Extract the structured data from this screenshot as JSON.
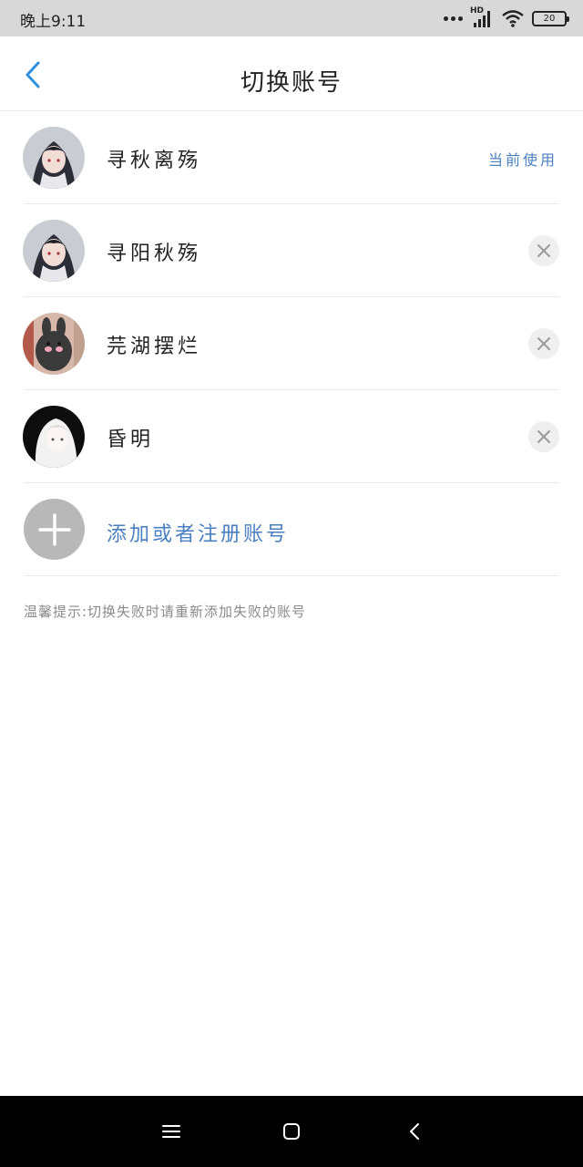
{
  "status_bar": {
    "time": "晚上9:11",
    "network_label": "HD",
    "battery_level": "20",
    "icons": [
      "more-dots-icon",
      "signal-icon",
      "wifi-icon",
      "battery-icon"
    ]
  },
  "header": {
    "title": "切换账号",
    "back_icon": "chevron-left-icon"
  },
  "accounts": [
    {
      "name": "寻秋离殇",
      "status": "当前使用",
      "avatar": "anime-hoodie-avatar"
    },
    {
      "name": "寻阳秋殇",
      "status": "",
      "avatar": "anime-hoodie-avatar",
      "action_icon": "close-icon"
    },
    {
      "name": "芫湖摆烂",
      "status": "",
      "avatar": "dark-bunny-avatar",
      "action_icon": "close-icon"
    },
    {
      "name": "昏明",
      "status": "",
      "avatar": "white-hair-avatar",
      "action_icon": "close-icon"
    }
  ],
  "add_account": {
    "label": "添加或者注册账号",
    "icon": "plus-icon"
  },
  "tip": "温馨提示:切换失败时请重新添加失败的账号",
  "nav_bar": {
    "icons": [
      "menu-icon",
      "home-square-icon",
      "back-triangle-icon"
    ]
  },
  "colors": {
    "accent": "#4a7fc1",
    "back_icon": "#2f8fe0",
    "status_bar_bg": "#d8d8d8",
    "nav_bar_bg": "#000000"
  }
}
